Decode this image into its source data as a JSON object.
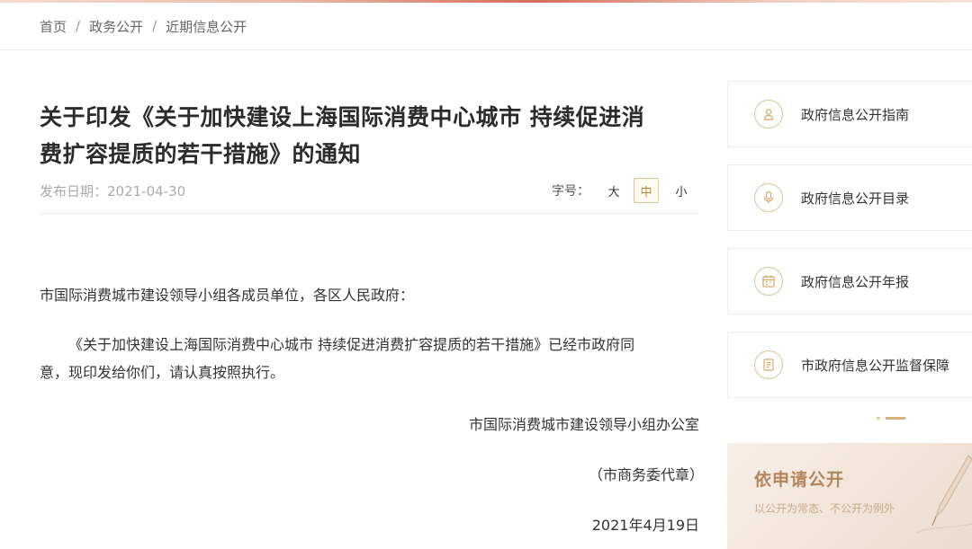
{
  "breadcrumb": {
    "home": "首页",
    "level1": "政务公开",
    "level2": "近期信息公开",
    "separator": "/"
  },
  "article": {
    "title_line1": "关于印发《关于加快建设上海国际消费中心城市 持续促进消",
    "title_line2": "费扩容提质的若干措施》的通知",
    "publish_date": "发布日期：2021-04-30",
    "font_size_label": "字号：",
    "font_sizes": [
      "大",
      "中",
      "小"
    ],
    "active_font_size": "中",
    "salutation": "市国际消费城市建设领导小组各成员单位，各区人民政府：",
    "paragraph_line1": "《关于加快建设上海国际消费中心城市 持续促进消费扩容提质的若干措施》已经市政府同",
    "paragraph_line2": "意，现印发给你们，请认真按照执行。",
    "signature_org": "市国际消费城市建设领导小组办公室",
    "signature_seal": "（市商务委代章）",
    "signature_date": "2021年4月19日"
  },
  "sidebar": {
    "items": [
      {
        "label": "政府信息公开指南",
        "icon": "guide-icon"
      },
      {
        "label": "政府信息公开目录",
        "icon": "catalog-icon"
      },
      {
        "label": "政府信息公开年报",
        "icon": "annual-report-icon"
      },
      {
        "label": "市政府信息公开监督保障",
        "icon": "supervision-icon"
      }
    ],
    "banner": {
      "title": "依申请公开",
      "subtitle": "以公开为常态、不公开为例外"
    }
  },
  "colors": {
    "accent_gold": "#d9b17a",
    "banner_title": "#b4845a",
    "title_text": "#2b2b2b"
  }
}
